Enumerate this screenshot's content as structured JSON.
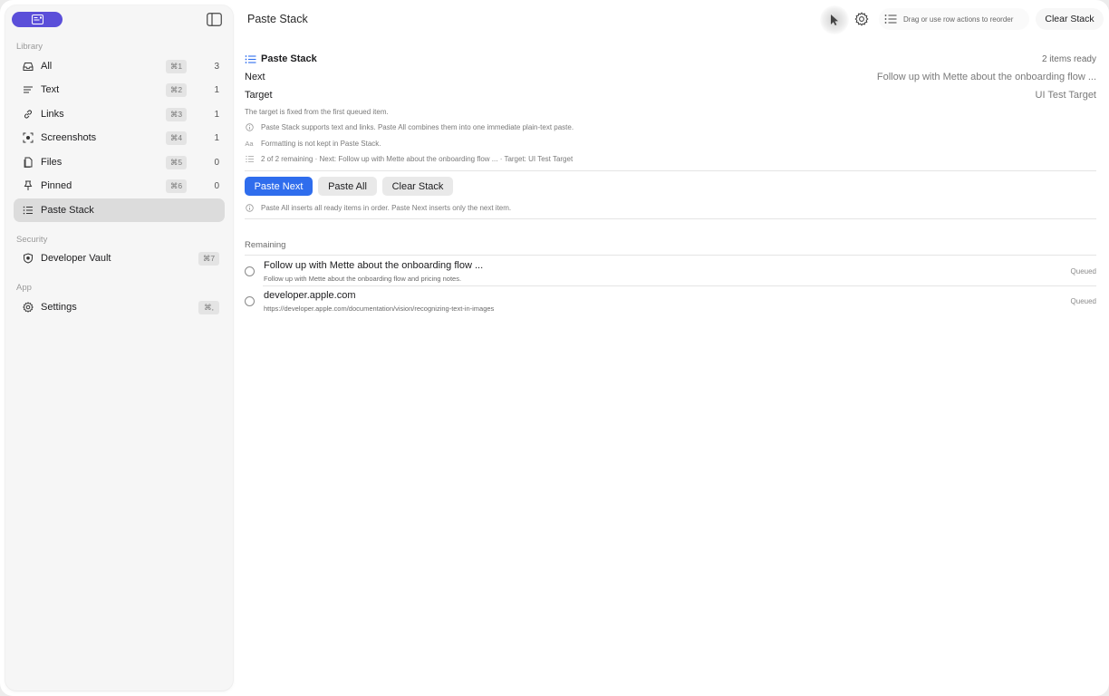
{
  "sidebar": {
    "sections": {
      "library": "Library",
      "security": "Security",
      "app": "App"
    },
    "items": [
      {
        "label": "All",
        "shortcut": "⌘1",
        "count": "3",
        "icon": "tray-icon"
      },
      {
        "label": "Text",
        "shortcut": "⌘2",
        "count": "1",
        "icon": "text-lines-icon"
      },
      {
        "label": "Links",
        "shortcut": "⌘3",
        "count": "1",
        "icon": "link-icon"
      },
      {
        "label": "Screenshots",
        "shortcut": "⌘4",
        "count": "1",
        "icon": "screenshot-icon"
      },
      {
        "label": "Files",
        "shortcut": "⌘5",
        "count": "0",
        "icon": "document-icon"
      },
      {
        "label": "Pinned",
        "shortcut": "⌘6",
        "count": "0",
        "icon": "pin-icon"
      },
      {
        "label": "Paste Stack",
        "icon": "list-icon",
        "active": true
      }
    ],
    "security_items": [
      {
        "label": "Developer Vault",
        "shortcut": "⌘7",
        "icon": "shield-icon"
      }
    ],
    "app_items": [
      {
        "label": "Settings",
        "shortcut": "⌘,",
        "icon": "gear-icon"
      }
    ]
  },
  "header": {
    "title": "Paste Stack",
    "hint": "Drag or use row actions to reorder",
    "clear_label": "Clear Stack"
  },
  "panel": {
    "title": "Paste Stack",
    "status": "2 items ready",
    "next_label": "Next",
    "next_value": "Follow up with Mette about the onboarding flow ...",
    "target_label": "Target",
    "target_value": "UI Test Target",
    "target_note": "The target is fixed from the first queued item.",
    "notes": [
      "Paste Stack supports text and links. Paste All combines them into one immediate plain-text paste.",
      "Formatting is not kept in Paste Stack.",
      "2 of 2 remaining · Next: Follow up with Mette about the onboarding flow ... · Target: UI Test Target"
    ],
    "note_icons": [
      "info-icon",
      "text-format-icon",
      "list-icon"
    ],
    "format_glyph": "Aa",
    "buttons": {
      "paste_next": "Paste Next",
      "paste_all": "Paste All",
      "clear_stack": "Clear Stack"
    },
    "button_note": "Paste All inserts all ready items in order. Paste Next inserts only the next item.",
    "remaining_label": "Remaining",
    "queue": [
      {
        "title": "Follow up with Mette about the onboarding flow ...",
        "subtitle": "Follow up with Mette about the onboarding flow and pricing notes.",
        "status": "Queued"
      },
      {
        "title": "developer.apple.com",
        "subtitle": "https://developer.apple.com/documentation/vision/recognizing-text-in-images",
        "status": "Queued"
      }
    ]
  },
  "colors": {
    "accent": "#2f6ded",
    "brand_pill": "#5b4fd9",
    "sidebar_bg": "#f6f6f6",
    "active_item": "#dcdcdc"
  }
}
